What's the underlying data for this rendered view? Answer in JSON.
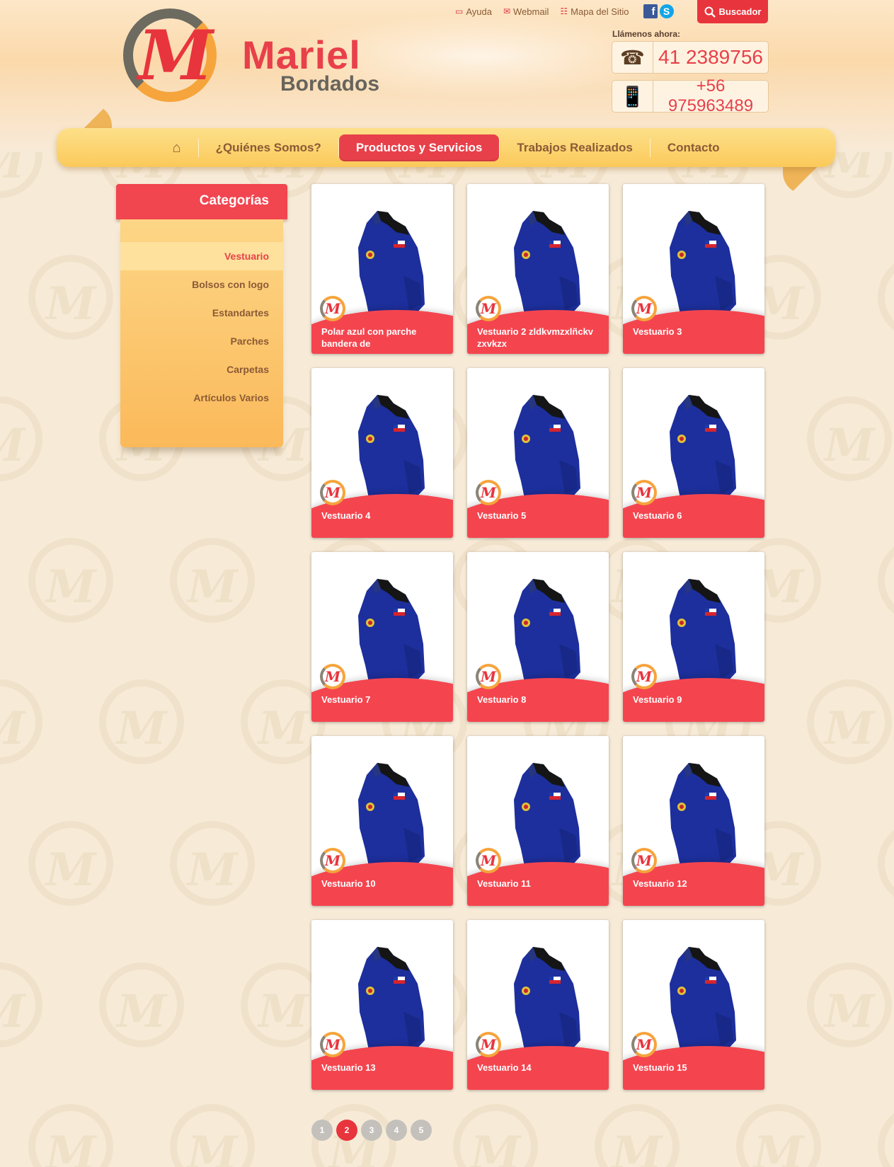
{
  "toplinks": {
    "ayuda": "Ayuda",
    "webmail": "Webmail",
    "mapa": "Mapa del Sitio",
    "buscador": "Buscador"
  },
  "logo": {
    "name": "Mariel",
    "sub": "Bordados",
    "mark": "M"
  },
  "contact": {
    "label": "Llámenos ahora:",
    "phone1": "41 2389756",
    "phone2": "+56 975963489"
  },
  "nav": {
    "items": [
      "¿Quiénes Somos?",
      "Productos y Servicios",
      "Trabajos Realizados",
      "Contacto"
    ],
    "active": "Productos y Servicios"
  },
  "sidebar": {
    "title": "Categorías",
    "items": [
      "Vestuario",
      "Bolsos con logo",
      "Estandartes",
      "Parches",
      "Carpetas",
      "Artículos Varios"
    ],
    "active": "Vestuario"
  },
  "products": [
    "Polar azul con parche bandera de",
    "Vestuario 2 zldkvmzxlñckv  zxvkzx",
    "Vestuario 3",
    "Vestuario 4",
    "Vestuario 5",
    "Vestuario 6",
    "Vestuario 7",
    "Vestuario 8",
    "Vestuario 9",
    "Vestuario 10",
    "Vestuario 11",
    "Vestuario 12",
    "Vestuario 13",
    "Vestuario 14",
    "Vestuario 15"
  ],
  "pagination": {
    "pages": [
      "1",
      "2",
      "3",
      "4",
      "5"
    ],
    "current": "2"
  },
  "colors": {
    "accent": "#e8404a",
    "nav": "#fbc95a",
    "brown": "#8b5a36",
    "jacket": "#1d2f9c"
  }
}
